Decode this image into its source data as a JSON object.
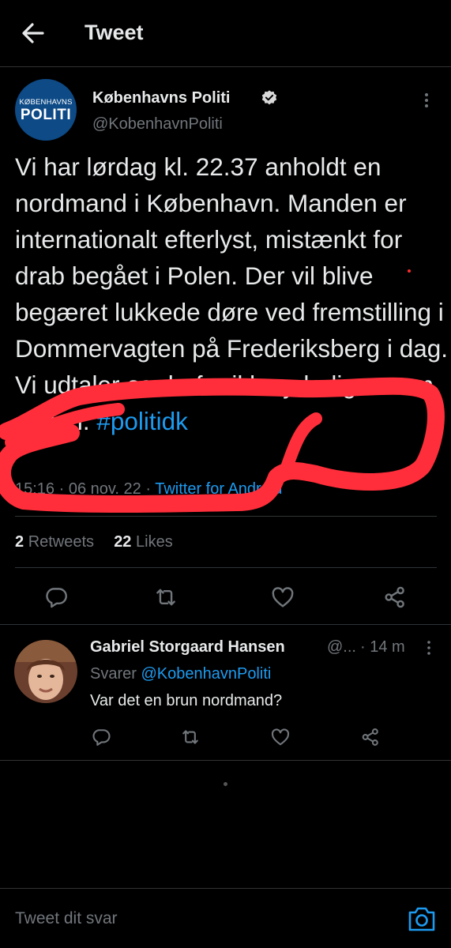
{
  "header": {
    "title": "Tweet"
  },
  "tweet": {
    "avatar_line1": "KØBENHAVNS",
    "avatar_line2": "POLITI",
    "author_name": "Københavns Politi",
    "author_handle": "@KobenhavnPoliti",
    "text": "Vi har lørdag kl. 22.37 anholdt en nordmand i København. Manden er internationalt efterlyst, mistænkt for drab begået i Polen. Der vil blive begæret lukkede døre ved fremstilling i Dommervagten på Frederiksberg i dag. Vi udtaler os derfor ikke yderligere om sagen. ",
    "hashtag": "#politidk",
    "time": "15:16",
    "date": "06 nov. 22",
    "separator": " · ",
    "source": "Twitter for Android",
    "retweets_count": "2",
    "retweets_label": "Retweets",
    "likes_count": "22",
    "likes_label": "Likes"
  },
  "actions": [
    "reply-icon",
    "retweet-icon",
    "like-icon",
    "share-icon"
  ],
  "reply": {
    "author_name": "Gabriel Storgaard Hansen",
    "author_handle": "@...",
    "time_sep": " · ",
    "time": "14 m",
    "replying_label": "Svarer ",
    "replying_to": "@KobenhavnPoliti",
    "text": "Var det en brun nordmand?"
  },
  "composer": {
    "placeholder": "Tweet dit svar"
  },
  "colors": {
    "background": "#000000",
    "text": "#e7e9ea",
    "secondary": "#71767b",
    "accent": "#1d9bf0",
    "annotation": "#ff2e3a"
  }
}
